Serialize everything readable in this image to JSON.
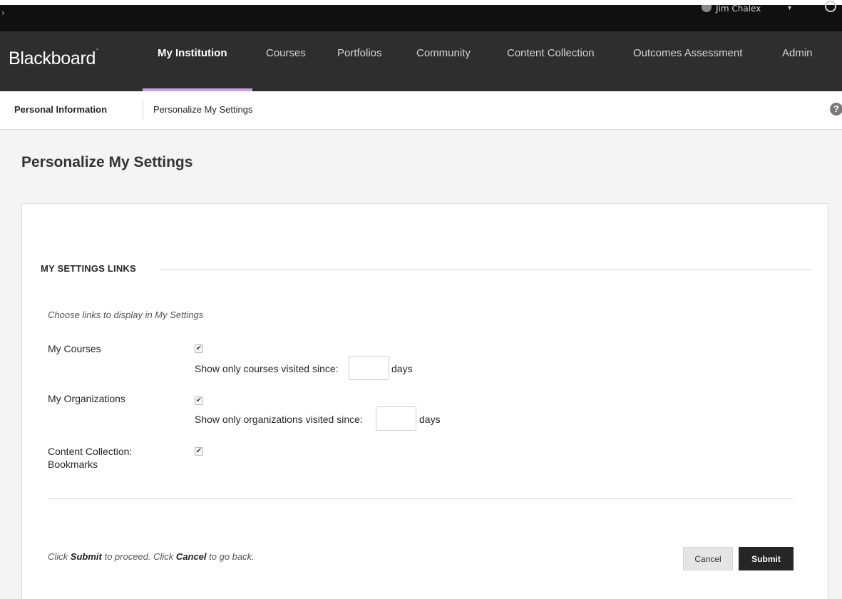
{
  "topbar": {
    "user_name": "Jim Chalex",
    "icons": [
      "menu-icon",
      "avatar-icon",
      "chevron-down-icon",
      "power-icon"
    ]
  },
  "nav": {
    "logo": "Blackboard",
    "items": [
      {
        "label": "My Institution",
        "active": true
      },
      {
        "label": "Courses"
      },
      {
        "label": "Portfolios"
      },
      {
        "label": "Community"
      },
      {
        "label": "Content Collection"
      },
      {
        "label": "Outcomes Assessment"
      },
      {
        "label": "Admin"
      }
    ],
    "active_underline_color": "#c7a0e0"
  },
  "breadcrumb": {
    "items": [
      "Personal Information",
      "Personalize My Settings"
    ],
    "help_glyph": "?"
  },
  "page": {
    "title": "Personalize My Settings"
  },
  "section": {
    "heading": "MY SETTINGS LINKS",
    "instructions": "Choose links to display in My Settings",
    "rows": [
      {
        "label": "My Courses",
        "checked": true,
        "sub_label": "Show only courses visited since:",
        "days_value": "",
        "days_unit": "days"
      },
      {
        "label": "My Organizations",
        "checked": true,
        "sub_label": "Show only organizations visited since:",
        "days_value": "",
        "days_unit": "days"
      },
      {
        "label_line1": "Content Collection:",
        "label_line2": "Bookmarks",
        "checked": true
      }
    ]
  },
  "footer": {
    "text_pre": "Click ",
    "text_submit": "Submit",
    "text_mid": " to proceed. Click ",
    "text_cancel": "Cancel",
    "text_post": " to go back.",
    "cancel_label": "Cancel",
    "submit_label": "Submit"
  },
  "checkmark_glyph": "✔"
}
